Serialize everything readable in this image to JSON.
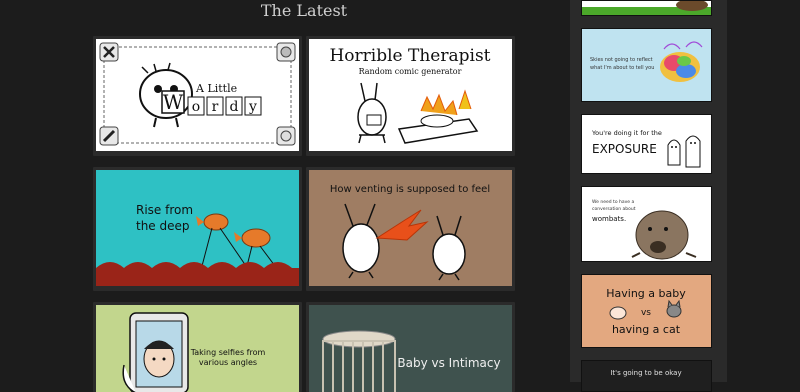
{
  "heading": "The Latest",
  "comics": {
    "wordy": {
      "line1": "A Little",
      "word": "Wordy",
      "letters": [
        "W",
        "o",
        "r",
        "d",
        "y"
      ]
    },
    "therapist": {
      "title": "Horrible Therapist",
      "subtitle": "Random comic generator"
    },
    "rise": {
      "line1": "Rise from",
      "line2": "the deep"
    },
    "venting": {
      "caption": "How venting is supposed to feel"
    },
    "selfies": {
      "line1": "Taking selfies from",
      "line2": "various angles"
    },
    "baby": {
      "caption": "Baby vs Intimacy"
    }
  },
  "sidebar": {
    "brain": {
      "line1": "Skies not going to reflect",
      "line2": "what I'm about to tell you"
    },
    "exposure": {
      "line1": "You're doing it for the",
      "word": "EXPOSURE"
    },
    "wombats": {
      "line1": "We need to have a",
      "line2": "conversation about",
      "line3": "wombats."
    },
    "babycat": {
      "line1": "Having a baby",
      "vs": "vs",
      "line2": "having a cat"
    },
    "okay": {
      "caption": "It's going to be okay"
    }
  },
  "colors": {
    "page_bg": "#1c1c1c",
    "tile_bg": "#2b2b2b",
    "sidebar_bg": "#2a2a2a",
    "heading": "#cfcfcf"
  }
}
